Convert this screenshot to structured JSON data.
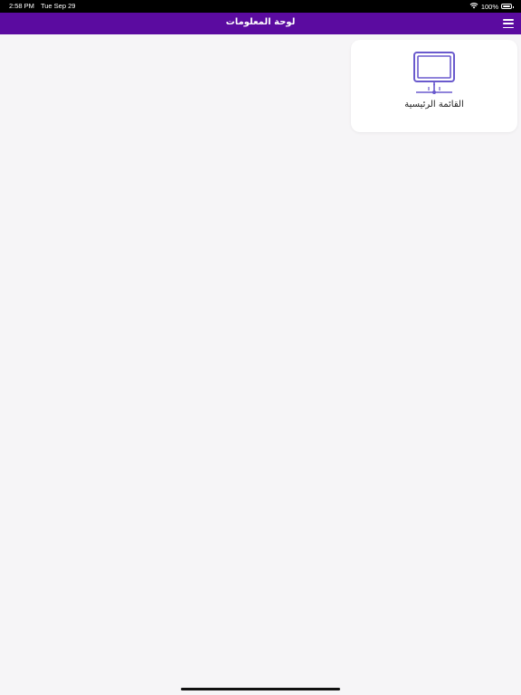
{
  "status_bar": {
    "time": "2:58 PM",
    "date": "Tue Sep 29",
    "battery_percent": "100%",
    "battery_level": 1.0,
    "wifi_icon": "wifi-icon",
    "battery_icon": "battery-icon"
  },
  "header": {
    "title": "لوحة المعلومات",
    "menu_icon": "hamburger-menu-icon",
    "background_color": "#5b0ba0"
  },
  "cards": [
    {
      "label": "القائمة الرئيسية",
      "icon": "monitor-icon",
      "icon_color": "#6a5acd"
    }
  ]
}
